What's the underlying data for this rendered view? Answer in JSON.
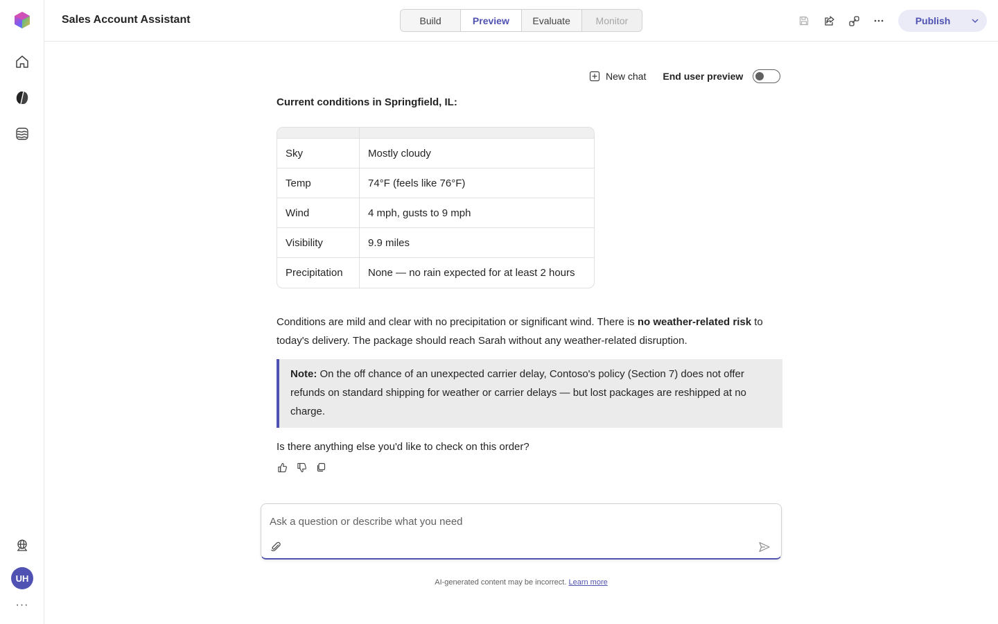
{
  "app": {
    "title": "Sales Account Assistant"
  },
  "tabs": [
    {
      "label": "Build"
    },
    {
      "label": "Preview"
    },
    {
      "label": "Evaluate"
    },
    {
      "label": "Monitor"
    }
  ],
  "publish": {
    "label": "Publish"
  },
  "chat": {
    "new_chat_label": "New chat",
    "end_user_preview_label": "End user preview",
    "end_user_preview_on": false
  },
  "message": {
    "heading": "Current conditions in Springfield, IL:",
    "rows": [
      {
        "key": "Sky",
        "value": "Mostly cloudy"
      },
      {
        "key": "Temp",
        "value": "74°F (feels like 76°F)"
      },
      {
        "key": "Wind",
        "value": "4 mph, gusts to 9 mph"
      },
      {
        "key": "Visibility",
        "value": "9.9 miles"
      },
      {
        "key": "Precipitation",
        "value": "None — no rain expected for at least 2 hours"
      }
    ],
    "para_part1": "Conditions are mild and clear with no precipitation or significant wind. There is ",
    "para_bold": "no weather-related risk",
    "para_part2": " to today's delivery. The package should reach Sarah without any weather-related disruption.",
    "note_label": "Note:",
    "note_text": " On the off chance of an unexpected carrier delay, Contoso's policy (Section 7) does not offer refunds on standard shipping for weather or carrier delays — but lost packages are reshipped at no charge.",
    "closing": "Is there anything else you'd like to check on this order?"
  },
  "composer": {
    "placeholder": "Ask a question or describe what you need"
  },
  "footer": {
    "disclaimer": "AI-generated content may be incorrect.",
    "learn_more": "Learn more"
  },
  "user": {
    "initials": "UH"
  },
  "colors": {
    "accent": "#4f52b2",
    "note_bg": "#ebebeb"
  }
}
